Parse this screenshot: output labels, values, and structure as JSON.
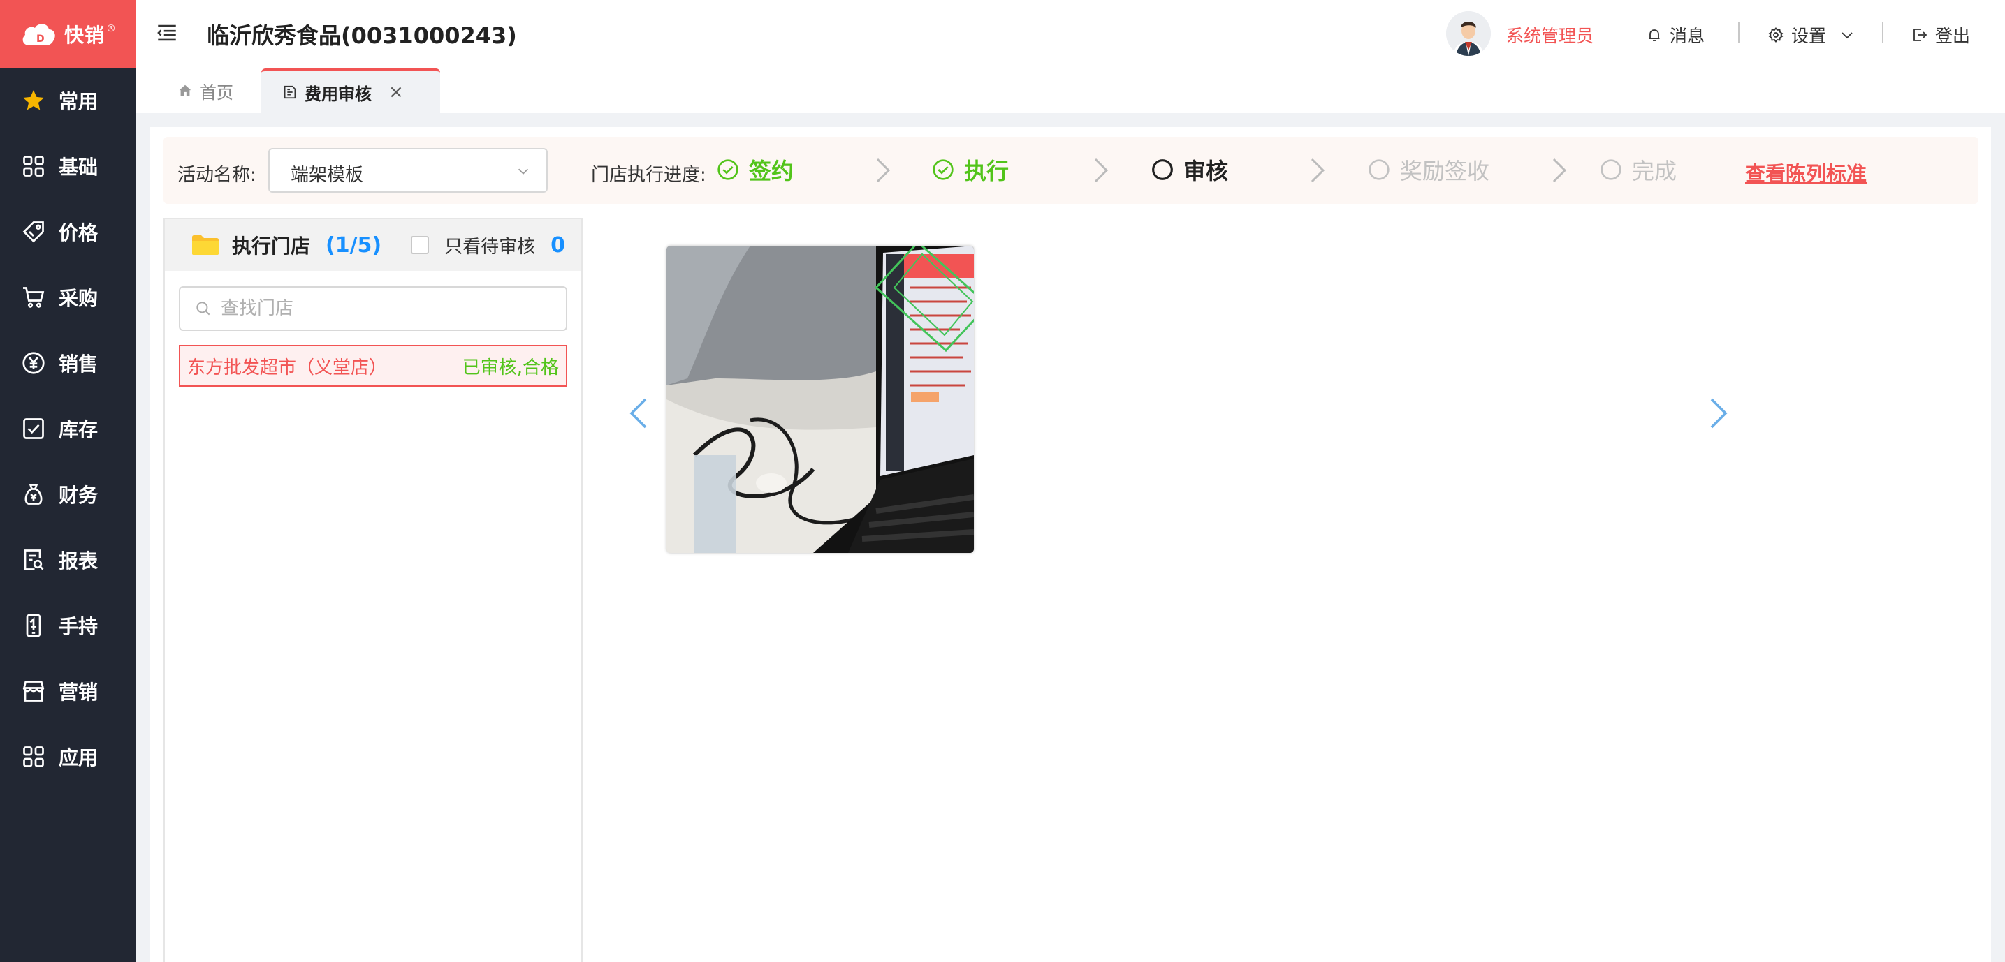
{
  "app": {
    "logo_text": "快销",
    "logo_mark": "®"
  },
  "sidebar": {
    "items": [
      {
        "label": "常用",
        "icon": "star-icon"
      },
      {
        "label": "基础",
        "icon": "grid-icon"
      },
      {
        "label": "价格",
        "icon": "tag-icon"
      },
      {
        "label": "采购",
        "icon": "cart-icon"
      },
      {
        "label": "销售",
        "icon": "yen-icon"
      },
      {
        "label": "库存",
        "icon": "checkbox-icon"
      },
      {
        "label": "财务",
        "icon": "money-bag-icon"
      },
      {
        "label": "报表",
        "icon": "report-icon"
      },
      {
        "label": "手持",
        "icon": "handheld-icon"
      },
      {
        "label": "营销",
        "icon": "store-icon"
      },
      {
        "label": "应用",
        "icon": "apps-icon"
      }
    ]
  },
  "header": {
    "company": "临沂欣秀食品(0031000243)",
    "user": "系统管理员",
    "messages": "消息",
    "settings": "设置",
    "logout": "登出"
  },
  "tabs": [
    {
      "label": "首页",
      "active": false
    },
    {
      "label": "费用审核",
      "active": true,
      "close": "×"
    }
  ],
  "progress": {
    "activity_label": "活动名称:",
    "activity_value": "端架模板",
    "progress_label": "门店执行进度:",
    "steps": [
      {
        "label": "签约",
        "state": "done"
      },
      {
        "label": "执行",
        "state": "done"
      },
      {
        "label": "审核",
        "state": "current"
      },
      {
        "label": "奖励签收",
        "state": "todo"
      },
      {
        "label": "完成",
        "state": "todo"
      }
    ],
    "view_standard": "查看陈列标准"
  },
  "stores": {
    "title": "执行门店",
    "count": "(1/5)",
    "pending_only_label": "只看待审核",
    "pending_count": "0",
    "search_placeholder": "查找门店",
    "list": [
      {
        "name": "东方批发超市（义堂店）",
        "status": "已审核,合格"
      }
    ]
  },
  "colors": {
    "accent": "#f25454",
    "sidebar": "#222733",
    "success": "#52c41a",
    "link": "#1890ff"
  }
}
